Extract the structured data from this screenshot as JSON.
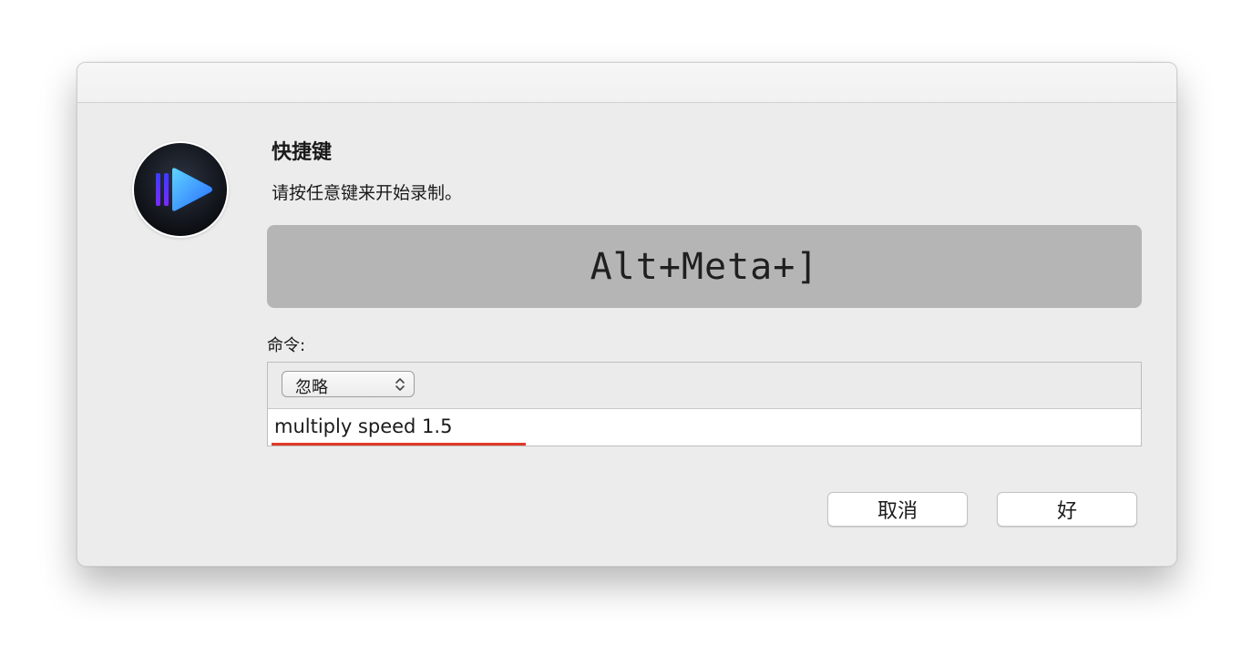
{
  "dialog": {
    "title": "快捷键",
    "subtitle": "请按任意键来开始录制。",
    "key_combo": "Alt+Meta+]",
    "command_label": "命令:",
    "command_type": {
      "selected": "忽略"
    },
    "command_value": "multiply speed 1.5",
    "buttons": {
      "cancel": "取消",
      "ok": "好"
    }
  },
  "app_icon": "iina-player-icon",
  "colors": {
    "key_display_bg": "#b5b5b5",
    "spellcheck_underline": "#e0392a",
    "icon_blue": "#3aa3ff"
  }
}
